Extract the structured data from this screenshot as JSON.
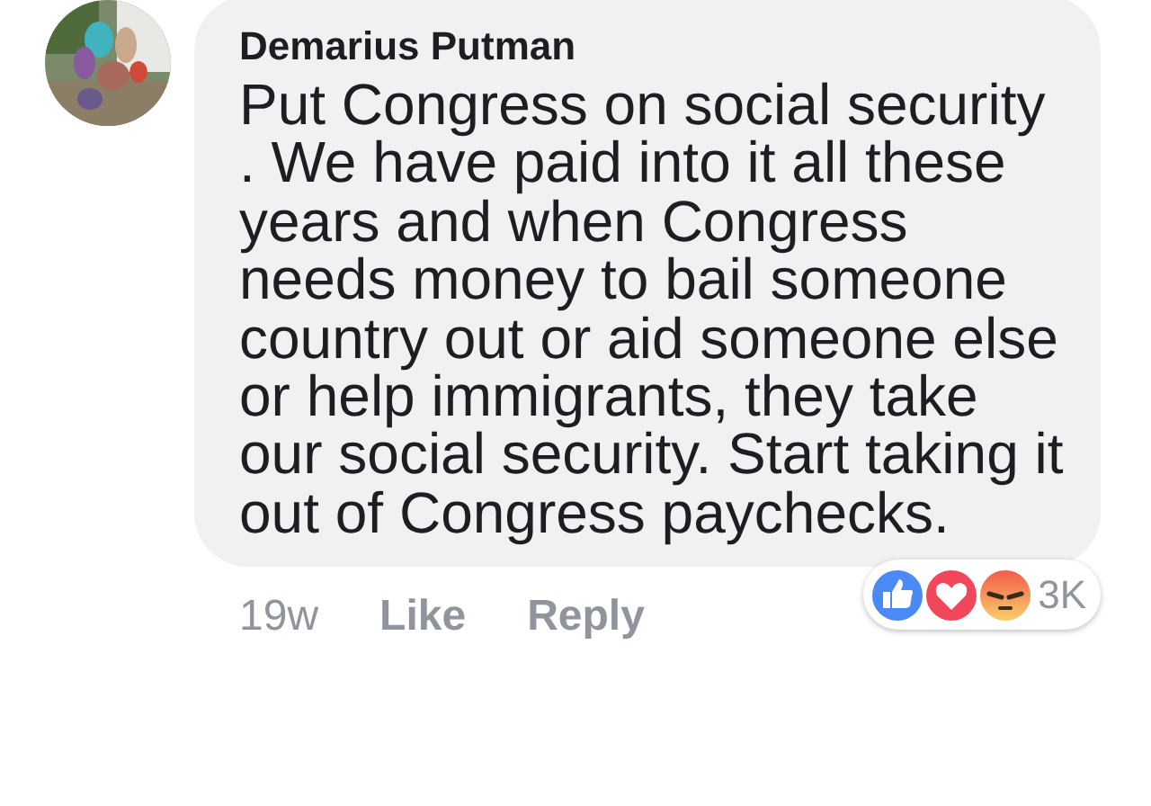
{
  "comment": {
    "author": "Demarius Putman",
    "text": "Put Congress on social security . We have paid into it all these years and when Congress needs money to bail someone country out or aid someone else or help immigrants, they take our social security. Start taking it out of Congress paychecks.",
    "time": "19w",
    "actions": [
      "Like",
      "Reply"
    ],
    "reactions": {
      "icons": [
        {
          "kind": "like"
        },
        {
          "kind": "love"
        },
        {
          "kind": "angry"
        }
      ],
      "count": "3K"
    }
  }
}
